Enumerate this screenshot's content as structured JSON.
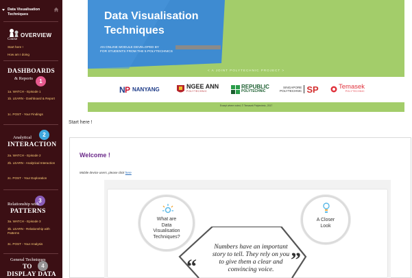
{
  "sidebar": {
    "course_title": "Data Visualisation Techniques",
    "overview": {
      "heading": "OVERVIEW",
      "sub": "Course"
    },
    "overview_links": [
      "Start here !",
      "How am I doing"
    ],
    "sections": [
      {
        "line1": "DASHBOARDS",
        "line2": "& Reports",
        "badge": "1",
        "badge_color": "#e85a8e",
        "links": [
          "1a. WATCH - Episode 1",
          "1b. LEARN - Dashboard & Report",
          "1c. POST - Your Findings"
        ]
      },
      {
        "line1": "Analytical",
        "line2": "INTERACTION",
        "badge": "2",
        "badge_color": "#3fa8de",
        "links": [
          "2a. WATCH - Episode 2",
          "2b. LEARN - Analytical Interaction",
          "2c. POST - Your Exploration"
        ]
      },
      {
        "line1": "Relationship with",
        "line2": "PATTERNS",
        "badge": "3",
        "badge_color": "#8a5cb8",
        "links": [
          "3a. WATCH - Episode 3",
          "3b. LEARN - Relationship with Patterns",
          "3c. POST - Your Analysis"
        ]
      },
      {
        "line1": "General Techniques",
        "line2": "TO",
        "line3": "DISPLAY DATA",
        "badge": "4",
        "badge_color": "#9a9a9a"
      }
    ]
  },
  "banner": {
    "title_line1": "Data Visualisation",
    "title_line2": "Techniques",
    "subtitle_line1": "AN ONLINE MODULE DEVELOPED BY",
    "subtitle_line2": "FOR STUDENTS FROM THE 5 POLYTECHNICS",
    "joint": "< A JOINT POLYTECHNIC PROJECT >",
    "logos": {
      "nyp": "NANYANG",
      "ngee_ann_1": "NGEE ANN",
      "ngee_ann_2": "POLYTECHNIC",
      "rp_1": "REPUBLIC",
      "rp_2": "POLYTECHNIC",
      "sp_small_1": "SINGAPORE",
      "sp_small_2": "POLYTECHNIC",
      "sp": "SP",
      "temasek_1": "Temasek",
      "temasek_2": "POLYTECHNIC"
    },
    "copyright": "Except where noted, © Temasek Polytechnic, 2017",
    "accent": "#a3cd6a",
    "blue": "#3e8bd1"
  },
  "main": {
    "start_here": "Start here !",
    "welcome": "Welcome !",
    "mobile_note": "Mobile device users, please click ",
    "mobile_link": "here",
    "what_are": [
      "What are",
      "Data",
      "Visualisation",
      "Techniques?"
    ],
    "closer_look": [
      "A Closer",
      "Look"
    ],
    "quote": [
      "Numbers have an important",
      "story to tell. They rely on you",
      "to give them a clear and",
      "convincing voice."
    ]
  }
}
